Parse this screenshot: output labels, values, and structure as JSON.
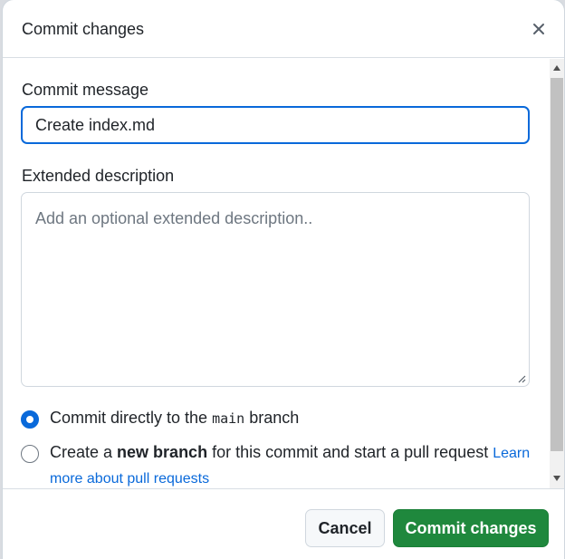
{
  "dialog": {
    "title": "Commit changes"
  },
  "form": {
    "commit_message_label": "Commit message",
    "commit_message_value": "Create index.md",
    "extended_description_label": "Extended description",
    "extended_description_placeholder": "Add an optional extended description..",
    "options": {
      "direct": {
        "prefix": "Commit directly to the ",
        "branch": "main",
        "suffix": " branch",
        "selected": true
      },
      "new_branch": {
        "prefix": "Create a ",
        "bold": "new branch",
        "suffix": " for this commit and start a pull request ",
        "link_line1": "Learn",
        "link_line2": "more about pull requests",
        "selected": false
      }
    }
  },
  "footer": {
    "cancel_label": "Cancel",
    "commit_label": "Commit changes"
  },
  "colors": {
    "accent": "#0969da",
    "primary_button": "#1f883d"
  },
  "icons": {
    "close": "close-icon",
    "resize": "resize-grip-icon"
  }
}
